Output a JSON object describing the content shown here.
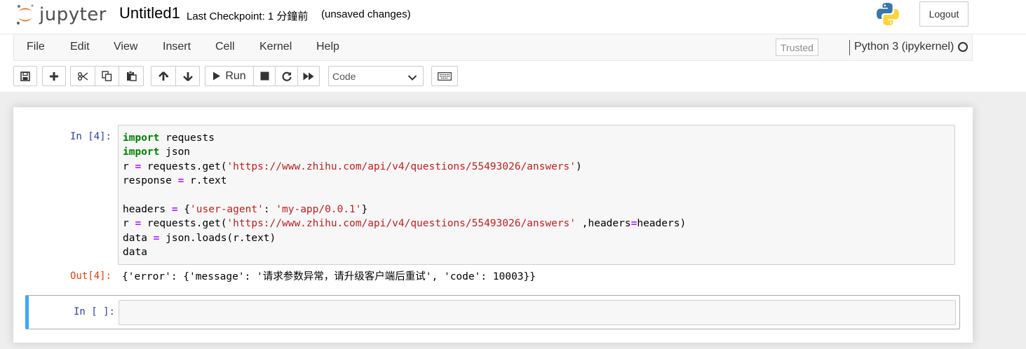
{
  "header": {
    "logo_text": "jupyter",
    "notebook_title": "Untitled1",
    "checkpoint": "Last Checkpoint: 1 分鐘前",
    "autosave_status": "(unsaved changes)",
    "logout_label": "Logout"
  },
  "menubar": {
    "items": [
      {
        "label": "File"
      },
      {
        "label": "Edit"
      },
      {
        "label": "View"
      },
      {
        "label": "Insert"
      },
      {
        "label": "Cell"
      },
      {
        "label": "Kernel"
      },
      {
        "label": "Help"
      }
    ],
    "trusted_label": "Trusted",
    "kernel_name": "Python 3 (ipykernel)"
  },
  "toolbar": {
    "run_label": "Run",
    "cell_type": "Code",
    "icons": [
      "save-icon",
      "plus-icon",
      "cut-icon",
      "copy-icon",
      "paste-icon",
      "arrow-up-icon",
      "arrow-down-icon",
      "play-icon",
      "stop-icon",
      "restart-icon",
      "fast-forward-icon",
      "keyboard-icon"
    ]
  },
  "cells": [
    {
      "in_prompt": "In [4]:",
      "code_lines": [
        "import requests",
        "import json",
        "r = requests.get('https://www.zhihu.com/api/v4/questions/55493026/answers')",
        "response = r.text",
        "",
        "headers = {'user-agent': 'my-app/0.0.1'}",
        "r = requests.get('https://www.zhihu.com/api/v4/questions/55493026/answers' ,headers=headers)",
        "data = json.loads(r.text)",
        "data"
      ],
      "out_prompt": "Out[4]:",
      "output": "{'error': {'message': '请求参数异常，请升级客户端后重试', 'code': 10003}}"
    },
    {
      "in_prompt": "In [ ]:",
      "code_lines": []
    }
  ],
  "colors": {
    "in_prompt": "#303f9f",
    "out_prompt": "#d84315",
    "keyword": "#008000",
    "string": "#ba2121",
    "operator": "#aa22ff",
    "selected_cell_border": "#42a5f5"
  }
}
